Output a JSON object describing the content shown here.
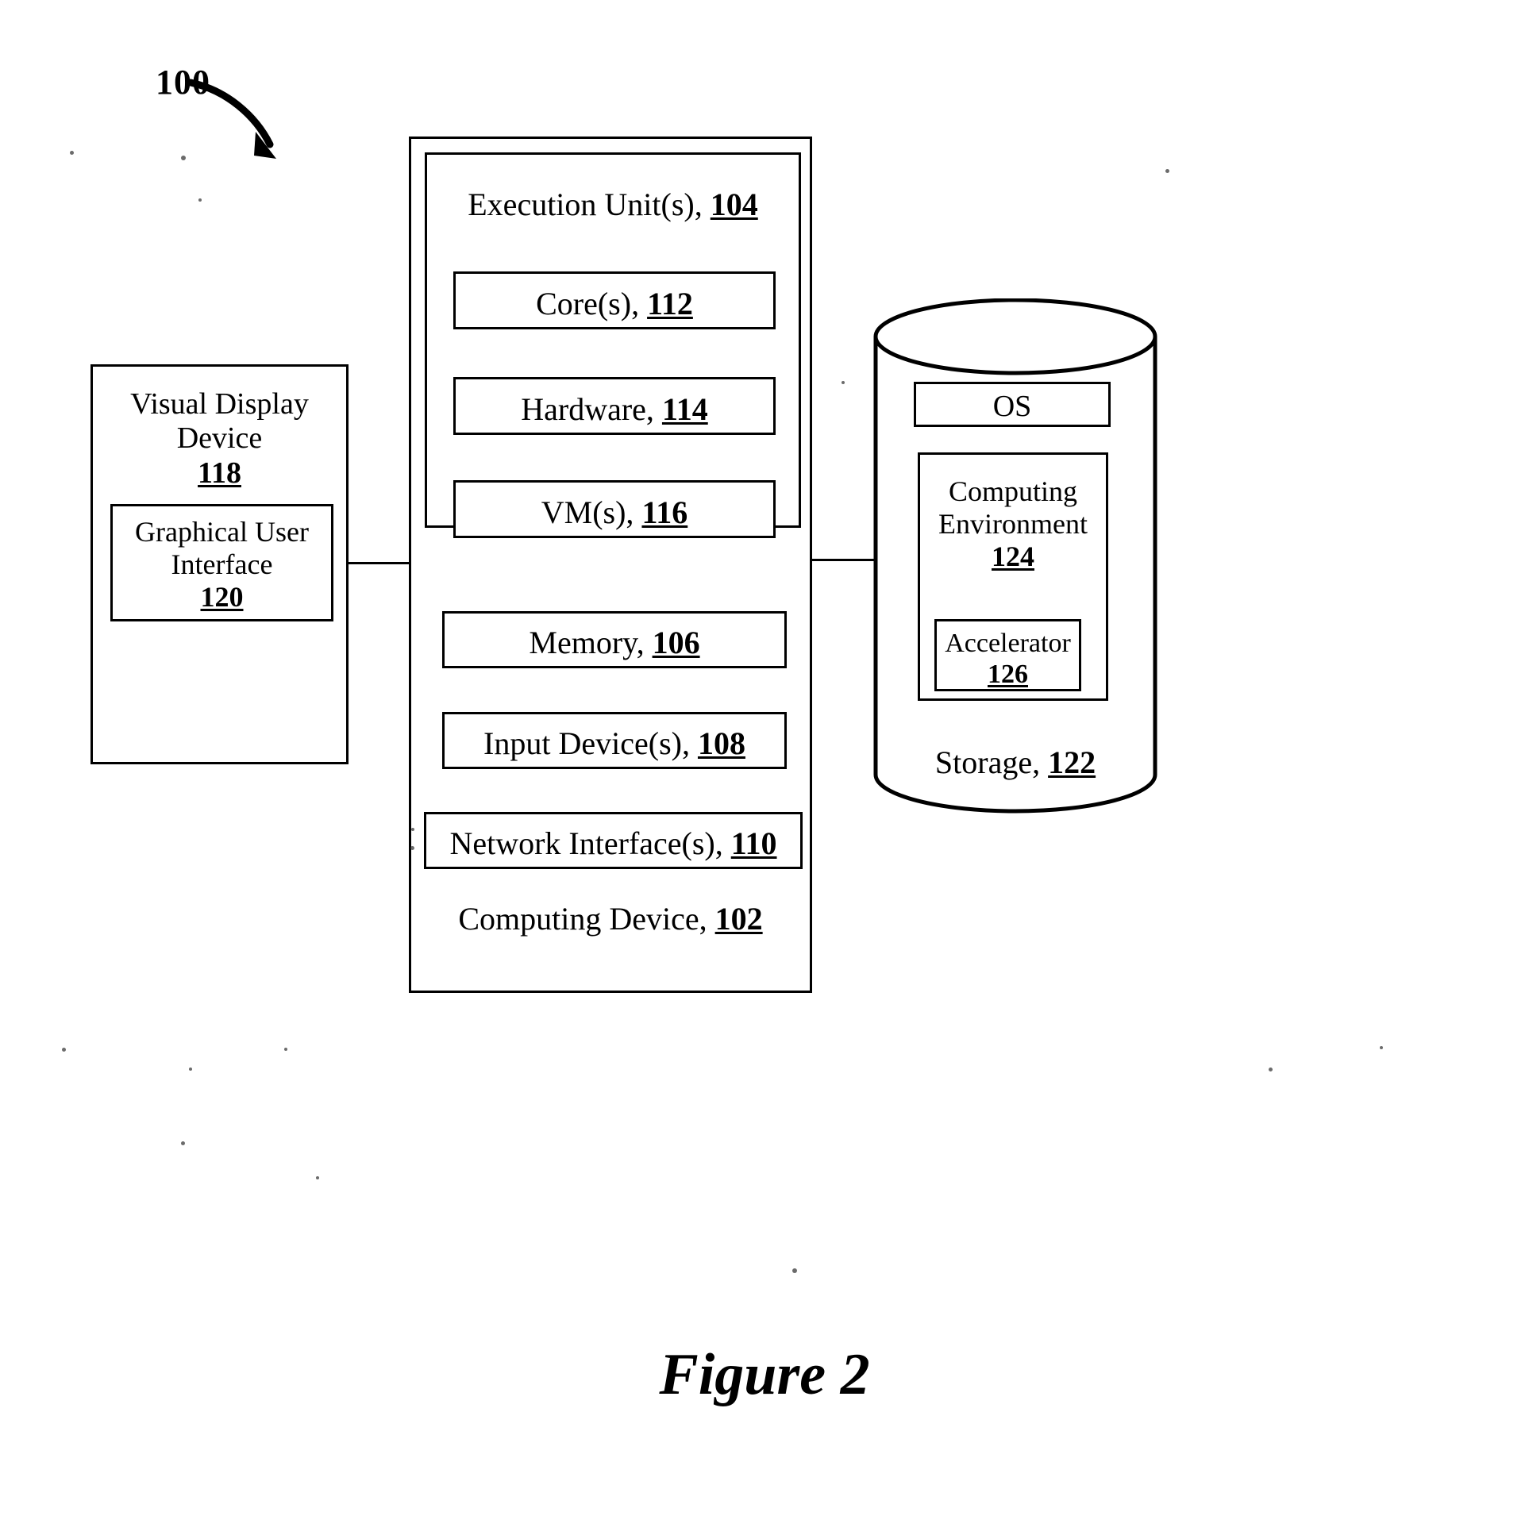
{
  "figure": {
    "ref_label": "100",
    "caption": "Figure 2"
  },
  "display": {
    "title_line1": "Visual Display",
    "title_line2": "Device",
    "ref": "118",
    "gui": {
      "line1": "Graphical User",
      "line2": "Interface",
      "ref": "120"
    }
  },
  "computing_device": {
    "label": "Computing Device,",
    "ref": "102",
    "execution_unit": {
      "label": "Execution Unit(s),",
      "ref": "104",
      "items": [
        {
          "label": "Core(s),",
          "ref": "112"
        },
        {
          "label": "Hardware,",
          "ref": "114"
        },
        {
          "label": "VM(s),",
          "ref": "116"
        }
      ]
    },
    "components": [
      {
        "label": "Memory,",
        "ref": "106"
      },
      {
        "label": "Input Device(s),",
        "ref": "108"
      },
      {
        "label": "Network Interface(s),",
        "ref": "110"
      }
    ]
  },
  "storage": {
    "label": "Storage,",
    "ref": "122",
    "os": {
      "label": "OS"
    },
    "computing_environment": {
      "line1": "Computing",
      "line2": "Environment",
      "ref": "124",
      "accelerator": {
        "label": "Accelerator",
        "ref": "126"
      }
    }
  }
}
